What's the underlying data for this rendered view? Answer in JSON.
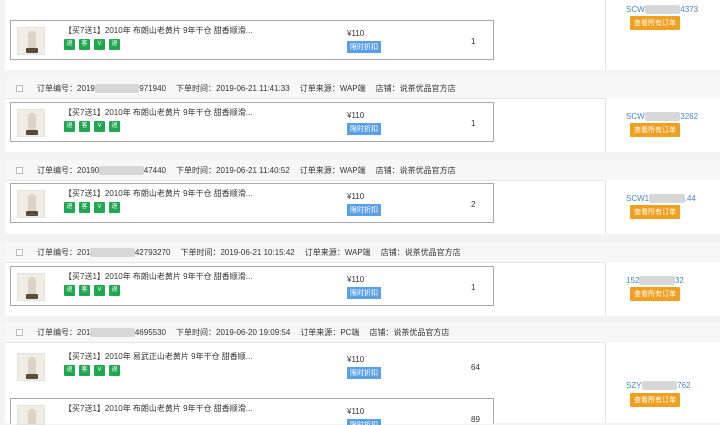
{
  "product_title": "【买7送1】2010年 布朗山老黄片 9年干仓 甜香顺滑...",
  "product_title_2": "【买7送1】2010年 易武正山老黄片 9年干仓 甜香顺...",
  "tags": [
    "退",
    "客",
    "V",
    "退"
  ],
  "price": "¥110",
  "discount_badge": "限时折扣",
  "view_orders_button": "查看所有订单",
  "order_no_label": "订单编号：",
  "order_time_label": "下单时间：",
  "source_label": "订单来源：",
  "shop_label": "店铺：",
  "shop_name": "说茶优品官方店",
  "top": {
    "customer_prefix": "SCW",
    "customer_suffix": "4373",
    "qty": "1"
  },
  "orders": [
    {
      "no_prefix": "2019",
      "no_suffix": "971940",
      "time": "2019-06-21 11:41:33",
      "source": "WAP端",
      "qty": "1",
      "customer_prefix": "SCW",
      "customer_suffix": "3262"
    },
    {
      "no_prefix": "20190",
      "no_suffix": "47440",
      "time": "2019-06-21 11:40:52",
      "source": "WAP端",
      "qty": "2",
      "customer_prefix": "SCW1",
      "customer_suffix": ".44"
    },
    {
      "no_prefix": "201",
      "no_suffix": "42793270",
      "time": "2019-06-21 10:15:42",
      "source": "WAP端",
      "qty": "1",
      "customer_prefix": "152",
      "customer_suffix": "32"
    },
    {
      "no_prefix": "201",
      "no_suffix": "4695530",
      "time": "2019-06-20 19:09:54",
      "source": "PC端",
      "qty_a": "64",
      "qty_b": "89",
      "customer_prefix": "SZY",
      "customer_suffix": "762"
    }
  ]
}
